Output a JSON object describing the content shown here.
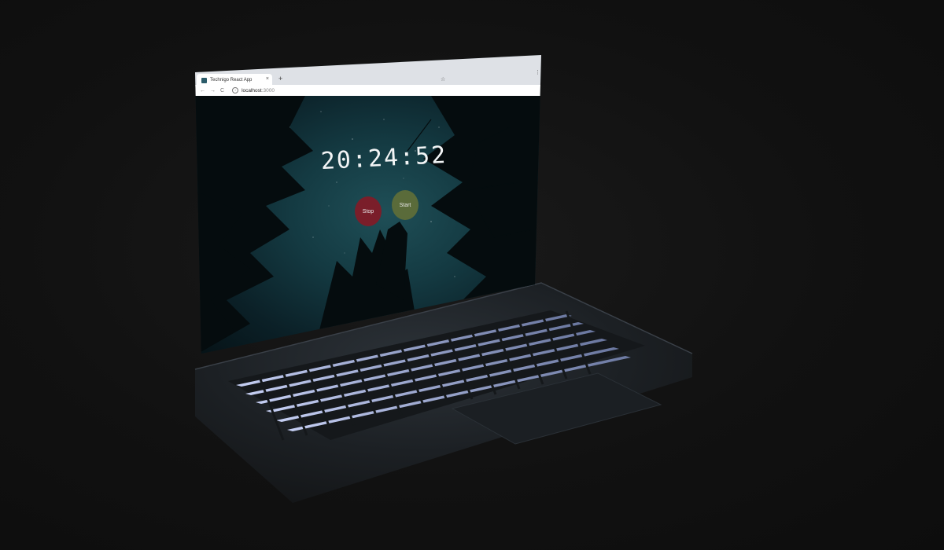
{
  "browser": {
    "tab_title": "Technigo React App",
    "tab_close": "×",
    "new_tab": "+",
    "star": "☆",
    "menu": "⋮",
    "back": "←",
    "forward": "→",
    "reload": "C",
    "info": "i",
    "url_host": "localhost",
    "url_port": ":3000"
  },
  "app": {
    "time": "20:24:52",
    "stop_label": "Stop",
    "start_label": "Start"
  },
  "colors": {
    "stop": "#7a1e2a",
    "start": "#5a6b3a",
    "background": "#111111"
  },
  "icons": [
    "favicon-icon",
    "close-icon",
    "plus-icon",
    "star-icon",
    "kebab-menu-icon",
    "back-arrow-icon",
    "forward-arrow-icon",
    "reload-icon",
    "info-icon"
  ]
}
